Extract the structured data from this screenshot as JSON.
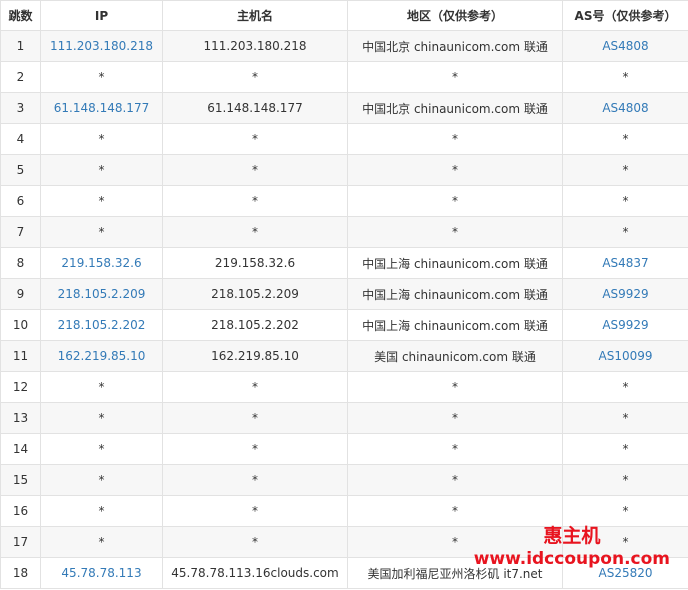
{
  "headers": [
    "跳数",
    "IP",
    "主机名",
    "地区（仅供参考）",
    "AS号（仅供参考）"
  ],
  "rows": [
    {
      "hop": "1",
      "ip": "111.203.180.218",
      "host": "111.203.180.218",
      "region": "中国北京 chinaunicom.com 联通",
      "as": "AS4808"
    },
    {
      "hop": "2",
      "ip": "*",
      "host": "*",
      "region": "*",
      "as": "*"
    },
    {
      "hop": "3",
      "ip": "61.148.148.177",
      "host": "61.148.148.177",
      "region": "中国北京 chinaunicom.com 联通",
      "as": "AS4808"
    },
    {
      "hop": "4",
      "ip": "*",
      "host": "*",
      "region": "*",
      "as": "*"
    },
    {
      "hop": "5",
      "ip": "*",
      "host": "*",
      "region": "*",
      "as": "*"
    },
    {
      "hop": "6",
      "ip": "*",
      "host": "*",
      "region": "*",
      "as": "*"
    },
    {
      "hop": "7",
      "ip": "*",
      "host": "*",
      "region": "*",
      "as": "*"
    },
    {
      "hop": "8",
      "ip": "219.158.32.6",
      "host": "219.158.32.6",
      "region": "中国上海 chinaunicom.com 联通",
      "as": "AS4837"
    },
    {
      "hop": "9",
      "ip": "218.105.2.209",
      "host": "218.105.2.209",
      "region": "中国上海 chinaunicom.com 联通",
      "as": "AS9929"
    },
    {
      "hop": "10",
      "ip": "218.105.2.202",
      "host": "218.105.2.202",
      "region": "中国上海 chinaunicom.com 联通",
      "as": "AS9929"
    },
    {
      "hop": "11",
      "ip": "162.219.85.10",
      "host": "162.219.85.10",
      "region": "美国 chinaunicom.com 联通",
      "as": "AS10099"
    },
    {
      "hop": "12",
      "ip": "*",
      "host": "*",
      "region": "*",
      "as": "*"
    },
    {
      "hop": "13",
      "ip": "*",
      "host": "*",
      "region": "*",
      "as": "*"
    },
    {
      "hop": "14",
      "ip": "*",
      "host": "*",
      "region": "*",
      "as": "*"
    },
    {
      "hop": "15",
      "ip": "*",
      "host": "*",
      "region": "*",
      "as": "*"
    },
    {
      "hop": "16",
      "ip": "*",
      "host": "*",
      "region": "*",
      "as": "*"
    },
    {
      "hop": "17",
      "ip": "*",
      "host": "*",
      "region": "*",
      "as": "*"
    },
    {
      "hop": "18",
      "ip": "45.78.78.113",
      "host": "45.78.78.113.16clouds.com",
      "region": "美国加利福尼亚州洛杉矶 it7.net",
      "as": "AS25820"
    }
  ],
  "watermark": {
    "brand": "惠主机",
    "url": "www.idccoupon.com"
  },
  "colors": {
    "link": "#337ab7",
    "text": "#333333",
    "border": "#e2e2e2",
    "stripe": "#f7f7f7",
    "watermark": "#e8141f"
  }
}
